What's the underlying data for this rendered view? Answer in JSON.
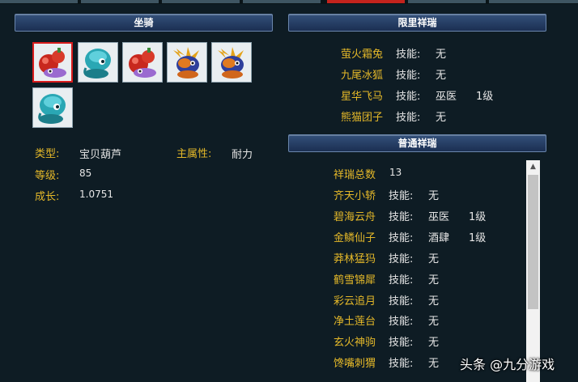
{
  "mount_panel": {
    "header": "坐骑",
    "slots": [
      {
        "icon": "red-gourd-mount-icon"
      },
      {
        "icon": "cyan-mount-icon"
      },
      {
        "icon": "red-gourd-mount-icon"
      },
      {
        "icon": "dragon-mount-icon"
      },
      {
        "icon": "dragon-mount-icon"
      },
      {
        "icon": "cyan-mount-icon"
      }
    ],
    "type_label": "类型:",
    "type_value": "宝贝葫芦",
    "attr_label": "主属性:",
    "attr_value": "耐力",
    "level_label": "等级:",
    "level_value": "85",
    "growth_label": "成长:",
    "growth_value": "1.0751"
  },
  "limited": {
    "header": "限里祥瑞",
    "rows": [
      {
        "name": "萤火霜兔",
        "skill_label": "技能:",
        "skill": "无",
        "level": ""
      },
      {
        "name": "九尾冰狐",
        "skill_label": "技能:",
        "skill": "无",
        "level": ""
      },
      {
        "name": "星华飞马",
        "skill_label": "技能:",
        "skill": "巫医",
        "level": "1级"
      },
      {
        "name": "熊猫团子",
        "skill_label": "技能:",
        "skill": "无",
        "level": ""
      }
    ]
  },
  "normal": {
    "header": "普通祥瑞",
    "total_label": "祥瑞总数",
    "total_value": "13",
    "rows": [
      {
        "name": "齐天小轿",
        "skill_label": "技能:",
        "skill": "无",
        "level": ""
      },
      {
        "name": "碧海云舟",
        "skill_label": "技能:",
        "skill": "巫医",
        "level": "1级"
      },
      {
        "name": "金鳞仙子",
        "skill_label": "技能:",
        "skill": "酒肆",
        "level": "1级"
      },
      {
        "name": "莽林猛犸",
        "skill_label": "技能:",
        "skill": "无",
        "level": ""
      },
      {
        "name": "鹤雪锦犀",
        "skill_label": "技能:",
        "skill": "无",
        "level": ""
      },
      {
        "name": "彩云追月",
        "skill_label": "技能:",
        "skill": "无",
        "level": ""
      },
      {
        "name": "净土莲台",
        "skill_label": "技能:",
        "skill": "无",
        "level": ""
      },
      {
        "name": "玄火神驹",
        "skill_label": "技能:",
        "skill": "无",
        "level": ""
      },
      {
        "name": "馋嘴刺猬",
        "skill_label": "技能:",
        "skill": "无",
        "level": ""
      }
    ]
  },
  "watermark": "头条 @九分游戏"
}
